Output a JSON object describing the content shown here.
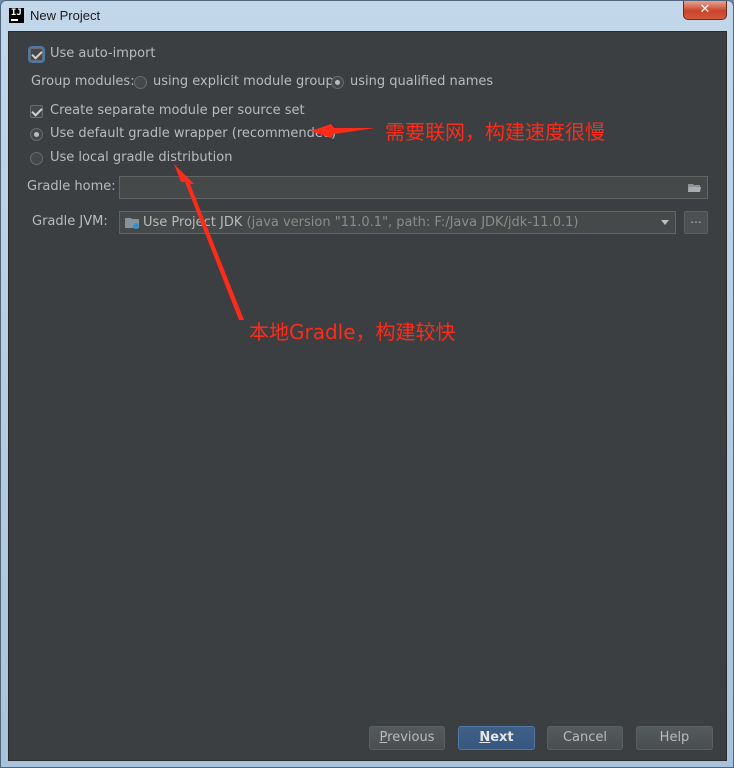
{
  "window": {
    "title": "New Project",
    "close_glyph": "✕",
    "app_icon": "intellij-idea-icon"
  },
  "options": {
    "auto_import": {
      "label": "Use auto-import",
      "checked": true
    },
    "group_modules": {
      "label": "Group modules:",
      "explicit": {
        "label": "using explicit module groups",
        "selected": false
      },
      "qualified": {
        "label": "using qualified names",
        "selected": true
      }
    },
    "separate_module": {
      "label": "Create separate module per source set",
      "checked": true
    },
    "default_wrapper": {
      "label": "Use default gradle wrapper (recommended)",
      "selected": true
    },
    "local_distribution": {
      "label": "Use local gradle distribution",
      "selected": false
    }
  },
  "gradle_home": {
    "label": "Gradle home:",
    "value": "",
    "icon": "folder-icon"
  },
  "gradle_jvm": {
    "label": "Gradle JVM:",
    "selected": "Use Project JDK",
    "detail": "(java version \"11.0.1\", path: F:/Java JDK/jdk-11.0.1)",
    "icon": "jdk-folder-icon",
    "browse_label": "..."
  },
  "annotations": {
    "wrapper_note": "需要联网，构建速度很慢",
    "local_note": "本地Gradle，构建较快",
    "color": "#ff2b1a"
  },
  "buttons": {
    "previous": "Previous",
    "next": "Next",
    "cancel": "Cancel",
    "help": "Help"
  },
  "colors": {
    "background": "#3c3f41",
    "text": "#bbbbbb",
    "primary_button": "#365880"
  }
}
